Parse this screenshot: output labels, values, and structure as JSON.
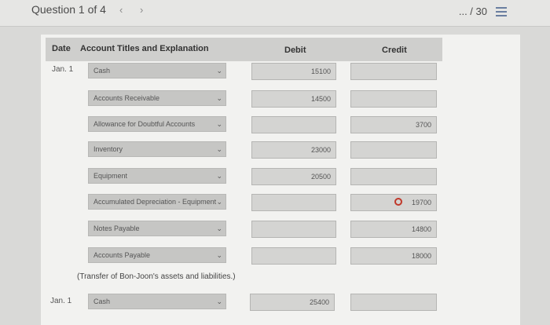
{
  "header": {
    "question_label": "Question 1 of 4",
    "prev_glyph": "‹",
    "next_glyph": "›",
    "points": "... / 30",
    "menu_icon": "list-icon"
  },
  "table": {
    "col_date": "Date",
    "col_account": "Account Titles and Explanation",
    "col_debit": "Debit",
    "col_credit": "Credit"
  },
  "rows": [
    {
      "date": "Jan. 1",
      "account": "Cash",
      "debit": "15100",
      "credit": ""
    },
    {
      "date": "",
      "account": "Accounts Receivable",
      "debit": "14500",
      "credit": ""
    },
    {
      "date": "",
      "account": "Allowance for Doubtful Accounts",
      "debit": "",
      "credit": "3700"
    },
    {
      "date": "",
      "account": "Inventory",
      "debit": "23000",
      "credit": ""
    },
    {
      "date": "",
      "account": "Equipment",
      "debit": "20500",
      "credit": ""
    },
    {
      "date": "",
      "account": "Accumulated Depreciation - Equipment",
      "debit": "",
      "credit": "19700"
    },
    {
      "date": "",
      "account": "Notes Payable",
      "debit": "",
      "credit": "14800"
    },
    {
      "date": "",
      "account": "Accounts Payable",
      "debit": "",
      "credit": "18000"
    }
  ],
  "explanation": "(Transfer of Bon-Joon's assets and liabilities.)",
  "row2": {
    "date": "Jan. 1",
    "account": "Cash",
    "debit": "25400",
    "credit": ""
  },
  "colors": {
    "error": "#c0392b",
    "menu_icon": "#6a7ea0"
  }
}
